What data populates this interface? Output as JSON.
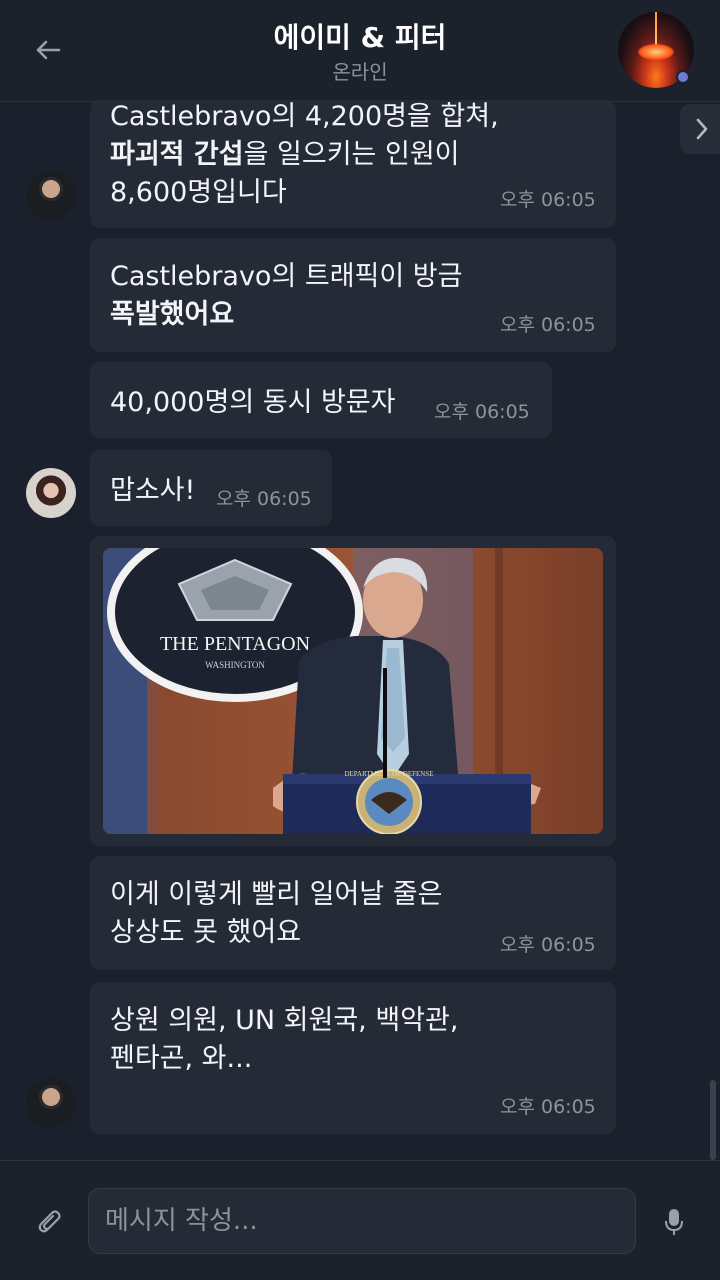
{
  "header": {
    "title": "에이미 & 피터",
    "status": "온라인"
  },
  "messages": [
    {
      "sender": "peter",
      "lines": [
        "Castlebravo의 4,200명을 합쳐,",
        "파괴적 간섭을 일으키는 인원이",
        "8,600명입니다"
      ],
      "bold": "파괴적 간섭",
      "time": "오후 06:05"
    },
    {
      "sender": "peter",
      "lines": [
        "Castlebravo의 트래픽이 방금",
        "폭발했어요"
      ],
      "time": "오후 06:05"
    },
    {
      "sender": "peter",
      "lines": [
        "40,000명의 동시 방문자"
      ],
      "time": "오후 06:05"
    },
    {
      "sender": "amy",
      "lines": [
        "맙소사!"
      ],
      "time": "오후 06:05"
    },
    {
      "sender": "peter",
      "image": {
        "sign_title": "THE PENTAGON",
        "sign_subtitle": "WASHINGTON",
        "seal_text": "DEPARTMENT OF DEFENSE"
      }
    },
    {
      "sender": "peter",
      "lines": [
        "이게 이렇게 빨리 일어날 줄은",
        "상상도 못 했어요"
      ],
      "time": "오후 06:05"
    },
    {
      "sender": "peter",
      "lines": [
        "상원 의원, UN 회원국, 백악관,",
        "펜타곤, 와..."
      ],
      "time": "오후 06:05"
    }
  ],
  "composer": {
    "placeholder": "메시지 작성..."
  },
  "colors": {
    "background": "#1b212c",
    "bubble": "#252b36",
    "online_dot": "#6f7bd6"
  },
  "icons": [
    "back-arrow-icon",
    "chevron-right-icon",
    "paperclip-icon",
    "microphone-icon"
  ]
}
